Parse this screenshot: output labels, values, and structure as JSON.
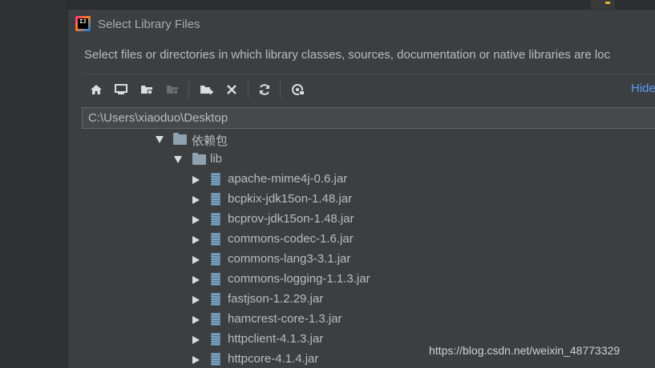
{
  "dialog": {
    "title": "Select Library Files",
    "description": "Select files or directories in which library classes, sources, documentation or native libraries are loc",
    "hide_label": "Hide",
    "path_value": "C:\\Users\\xiaoduo\\Desktop"
  },
  "toolbar": {
    "buttons": [
      "home-icon",
      "desktop-icon",
      "project-folder-icon",
      "module-folder-icon",
      "new-folder-icon",
      "delete-icon",
      "refresh-icon",
      "show-hidden-icon"
    ]
  },
  "tree": {
    "root_folder": "依赖包",
    "lib_folder": "lib",
    "files": [
      "apache-mime4j-0.6.jar",
      "bcpkix-jdk15on-1.48.jar",
      "bcprov-jdk15on-1.48.jar",
      "commons-codec-1.6.jar",
      "commons-lang3-3.1.jar",
      "commons-logging-1.1.3.jar",
      "fastjson-1.2.29.jar",
      "hamcrest-core-1.3.jar",
      "httpclient-4.1.3.jar",
      "httpcore-4.1.4.jar"
    ]
  },
  "watermark": "https://blog.csdn.net/weixin_48773329",
  "colors": {
    "background": "#3c3f41",
    "link": "#589df6",
    "text": "#bbbbbb"
  }
}
